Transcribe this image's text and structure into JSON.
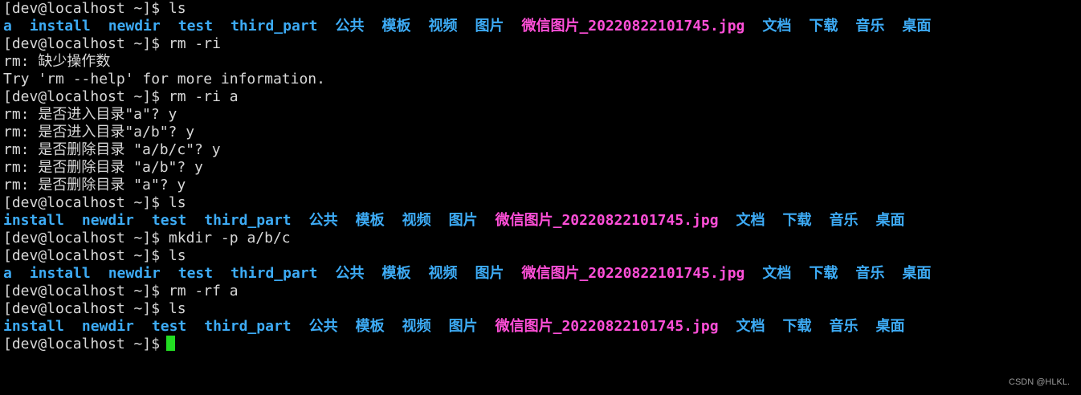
{
  "prompt": "[dev@localhost ~]$ ",
  "lines": [
    {
      "type": "cmd",
      "text": "ls"
    },
    {
      "type": "ls",
      "items": [
        "a",
        "install",
        "newdir",
        "test",
        "third_part",
        "公共",
        "模板",
        "视频",
        "图片",
        "微信图片_20220822101745.jpg",
        "文档",
        "下载",
        "音乐",
        "桌面"
      ]
    },
    {
      "type": "cmd",
      "text": "rm -ri"
    },
    {
      "type": "out",
      "text": "rm: 缺少操作数"
    },
    {
      "type": "out",
      "text": "Try 'rm --help' for more information."
    },
    {
      "type": "cmd",
      "text": "rm -ri a"
    },
    {
      "type": "out",
      "text": "rm: 是否进入目录\"a\"? y"
    },
    {
      "type": "out",
      "text": "rm: 是否进入目录\"a/b\"? y"
    },
    {
      "type": "out",
      "text": "rm: 是否删除目录 \"a/b/c\"? y"
    },
    {
      "type": "out",
      "text": "rm: 是否删除目录 \"a/b\"? y"
    },
    {
      "type": "out",
      "text": "rm: 是否删除目录 \"a\"? y"
    },
    {
      "type": "cmd",
      "text": "ls"
    },
    {
      "type": "ls",
      "items": [
        "install",
        "newdir",
        "test",
        "third_part",
        "公共",
        "模板",
        "视频",
        "图片",
        "微信图片_20220822101745.jpg",
        "文档",
        "下载",
        "音乐",
        "桌面"
      ]
    },
    {
      "type": "cmd",
      "text": "mkdir -p a/b/c"
    },
    {
      "type": "cmd",
      "text": "ls"
    },
    {
      "type": "ls",
      "items": [
        "a",
        "install",
        "newdir",
        "test",
        "third_part",
        "公共",
        "模板",
        "视频",
        "图片",
        "微信图片_20220822101745.jpg",
        "文档",
        "下载",
        "音乐",
        "桌面"
      ]
    },
    {
      "type": "cmd",
      "text": "rm -rf a"
    },
    {
      "type": "cmd",
      "text": "ls"
    },
    {
      "type": "ls",
      "items": [
        "install",
        "newdir",
        "test",
        "third_part",
        "公共",
        "模板",
        "视频",
        "图片",
        "微信图片_20220822101745.jpg",
        "文档",
        "下载",
        "音乐",
        "桌面"
      ]
    },
    {
      "type": "prompt",
      "text": ""
    }
  ],
  "colors": {
    "background": "#000000",
    "text": "#d8d8d8",
    "dir": "#3dabf5",
    "image_file": "#ff4fd8",
    "cursor": "#22dd22"
  },
  "watermark": "CSDN @HLKL."
}
